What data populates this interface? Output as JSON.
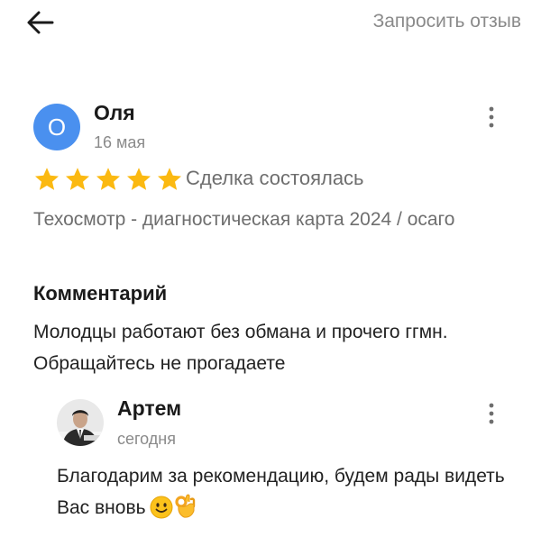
{
  "header": {
    "back_icon": "arrow-left-icon",
    "request_label": "Запросить отзыв"
  },
  "review": {
    "avatar_letter": "О",
    "avatar_color": "#4a90ef",
    "author": "Оля",
    "date": "16 мая",
    "rating": 5,
    "rating_max": 5,
    "star_color": "#fbb911",
    "deal_status": "Сделка состоялась",
    "service": "Техосмотр - диагностическая карта 2024 / осаго",
    "comment_heading": "Комментарий",
    "comment": "Молодцы работают без обмана и прочего ггмн. Обращайтесь не прогадаете",
    "menu_icon": "more-vertical-icon"
  },
  "reply": {
    "author": "Артем",
    "date": "сегодня",
    "text": "Благодарим за рекомендацию, будем рады видеть Вас вновь",
    "emojis": [
      "slightly-smiling-face-icon",
      "ok-hand-icon"
    ],
    "menu_icon": "more-vertical-icon"
  }
}
